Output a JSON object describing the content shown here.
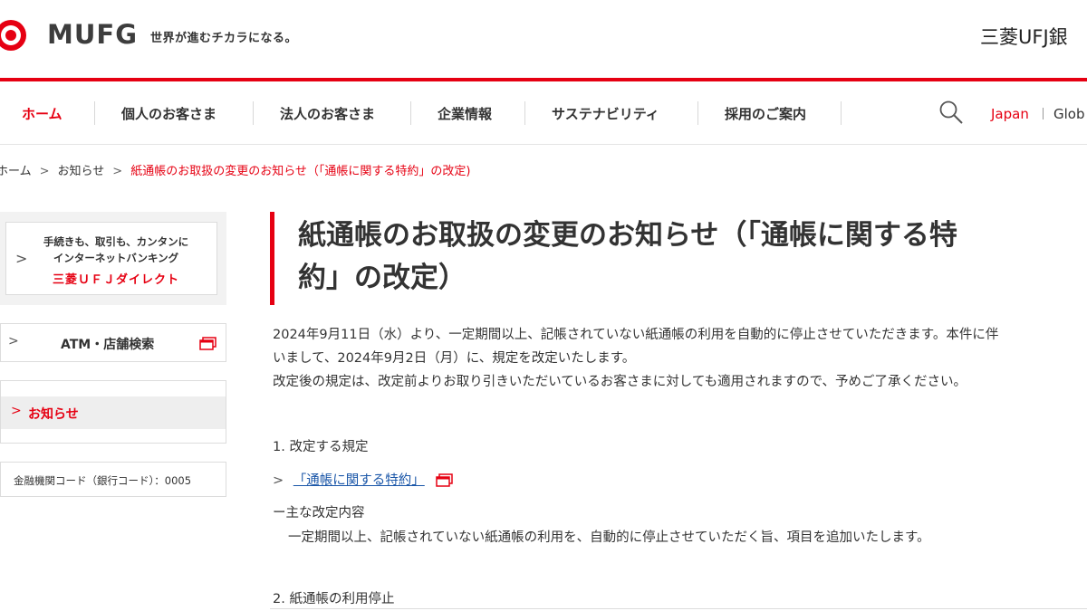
{
  "header": {
    "logo_text": "MUFG",
    "tagline": "世界が進むチカラになる。",
    "bank_name": "三菱UFJ銀"
  },
  "colors": {
    "brand_red": "#e60012",
    "link_blue": "#1a56a8"
  },
  "nav": {
    "items": [
      {
        "label": "ホーム",
        "active": true
      },
      {
        "label": "個人のお客さま",
        "active": false
      },
      {
        "label": "法人のお客さま",
        "active": false
      },
      {
        "label": "企業情報",
        "active": false
      },
      {
        "label": "サステナビリティ",
        "active": false
      },
      {
        "label": "採用のご案内",
        "active": false
      }
    ],
    "search_icon": "search-icon",
    "lang_japan": "Japan",
    "lang_global": "Glob"
  },
  "breadcrumb": {
    "items": [
      "ホーム",
      "お知らせ"
    ],
    "current": "紙通帳のお取扱の変更のお知らせ（「通帳に関する特約」の改定)"
  },
  "sidebar": {
    "direct": {
      "line1": "手続きも、取引も、カンタンに",
      "line2": "インターネットバンキング",
      "line3": "三菱ＵＦＪダイレクト"
    },
    "atm_label": "ATM・店舗検索",
    "news_label": "お知らせ",
    "bank_code": "金融機関コード（銀行コード）：0005"
  },
  "main": {
    "title_line1": "紙通帳のお取扱の変更のお知らせ（「通帳に関する特",
    "title_line2": "約」の改定）",
    "intro_line1": "2024年9月11日（水）より、一定期間以上、記帳されていない紙通帳の利用を自動的に停止させていただきます。本件に伴",
    "intro_line2": "いまして、2024年9月2日（月）に、規定を改定いたします。",
    "intro_line3": "改定後の規定は、改定前よりお取り引きいただいているお客さまに対しても適用されますので、予めご了承ください。",
    "section1_heading": "1. 改定する規定",
    "rule_link": "「通帳に関する特約」",
    "main_change_heading": "ー主な改定内容",
    "main_change_body": "一定期間以上、記帳されていない紙通帳の利用を、自動的に停止させていただく旨、項目を追加いたします。",
    "section2_heading": "2. 紙通帳の利用停止"
  }
}
